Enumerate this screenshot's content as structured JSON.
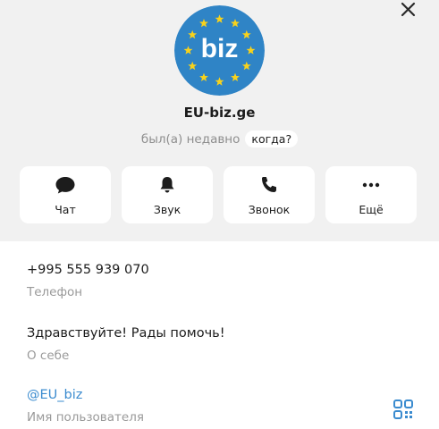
{
  "profile": {
    "avatar_text": "biz",
    "name": "EU-biz.ge",
    "status": "был(а) недавно",
    "status_when": "когда?"
  },
  "actions": [
    {
      "label": "Чат",
      "icon": "chat-bubble-icon"
    },
    {
      "label": "Звук",
      "icon": "bell-icon"
    },
    {
      "label": "Звонок",
      "icon": "phone-icon"
    },
    {
      "label": "Ещё",
      "icon": "more-dots-icon"
    }
  ],
  "info": {
    "phone_value": "+995 555 939 070",
    "phone_label": "Телефон",
    "about_value": "Здравствуйте! Рады помочь!",
    "about_label": "О себе",
    "username_value": "@EU_biz",
    "username_label": "Имя пользователя"
  },
  "colors": {
    "avatar_bg": "#2f84c6",
    "star": "#f8d21c",
    "link": "#3a8bcf",
    "accent": "#3a8bcf"
  }
}
